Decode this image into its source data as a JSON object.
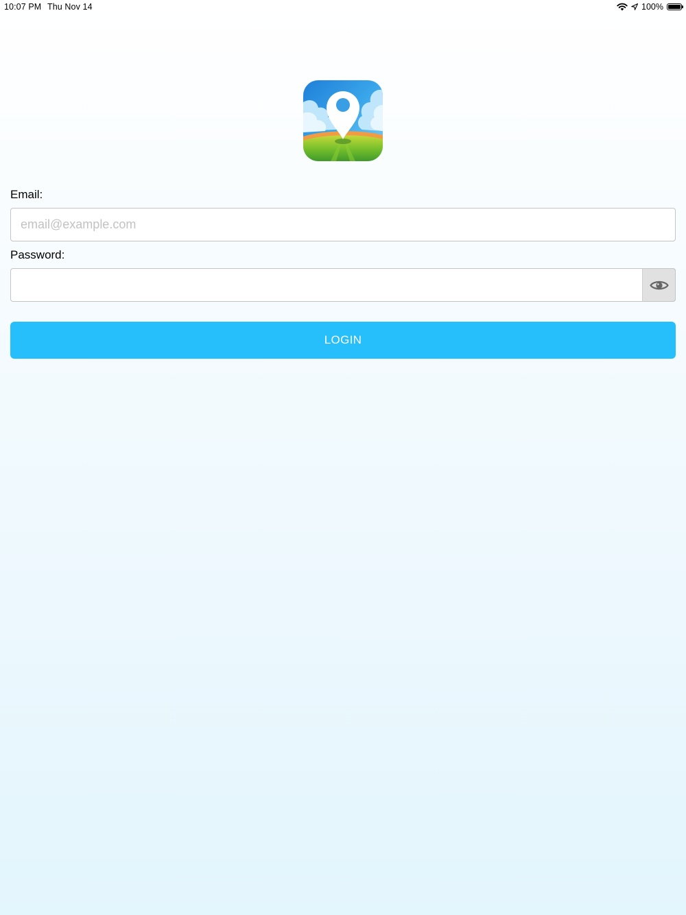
{
  "status_bar": {
    "time": "10:07 PM",
    "date": "Thu Nov 14",
    "battery_percent": "100%",
    "battery_level": 1.0,
    "icons": [
      "wifi-icon",
      "location-arrow-icon",
      "battery-icon"
    ]
  },
  "logo": {
    "icon": "map-pin-landscape-icon",
    "colors": {
      "sky": "#2a8fe0",
      "pin": "#ffffff",
      "ground": "#6cc02a",
      "horizon": "#f0a24a"
    }
  },
  "form": {
    "email_label": "Email:",
    "email_placeholder": "email@example.com",
    "email_value": "",
    "password_label": "Password:",
    "password_value": "",
    "toggle_icon": "eye-icon",
    "login_label": "LOGIN"
  },
  "colors": {
    "accent": "#26bffb",
    "input_border": "#c4c4c4",
    "placeholder": "#c2c2c4"
  }
}
